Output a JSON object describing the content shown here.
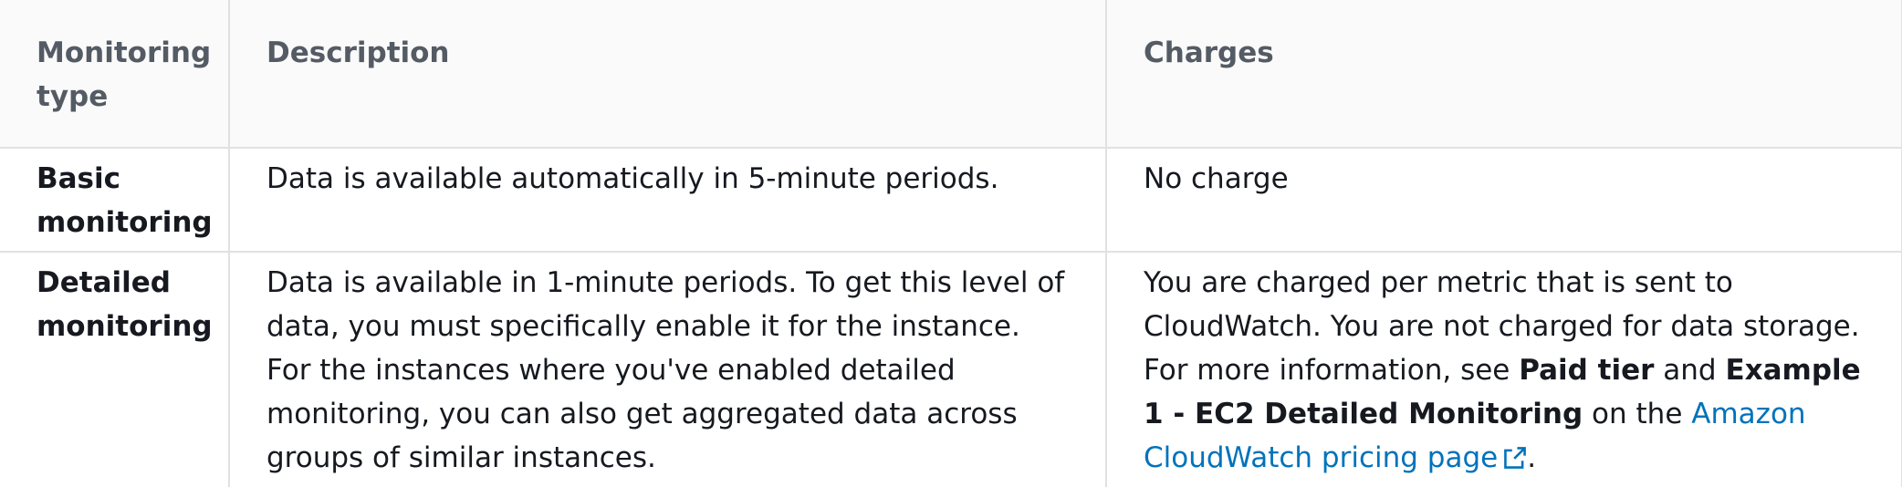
{
  "table": {
    "headers": {
      "type": "Monitoring type",
      "description": "Description",
      "charges": "Charges"
    },
    "rows": [
      {
        "type": "Basic monitoring",
        "description": "Data is available automatically in 5-minute periods.",
        "charges": "No charge"
      },
      {
        "type": "Detailed monitoring",
        "description": "Data is available in 1-minute periods. To get this level of data, you must specifically enable it for the instance. For the instances where you've enabled detailed monitoring, you can also get aggregated data across groups of similar instances.",
        "charges": {
          "text_1": "You are charged per metric that is sent to CloudWatch. You are not charged for data storage. For more information, see ",
          "bold_1": "Paid tier",
          "text_2": " and ",
          "bold_2": "Example 1 - EC2 Detailed Monitoring",
          "text_3": " on the ",
          "link_label": "Amazon CloudWatch pricing page",
          "text_4": "."
        }
      }
    ]
  },
  "icons": {
    "external_link": "external-link-icon"
  },
  "colors": {
    "header_bg": "#fafafa",
    "header_text": "#545b64",
    "body_text": "#16191f",
    "border": "#e1e1e1",
    "link": "#0073bb"
  }
}
